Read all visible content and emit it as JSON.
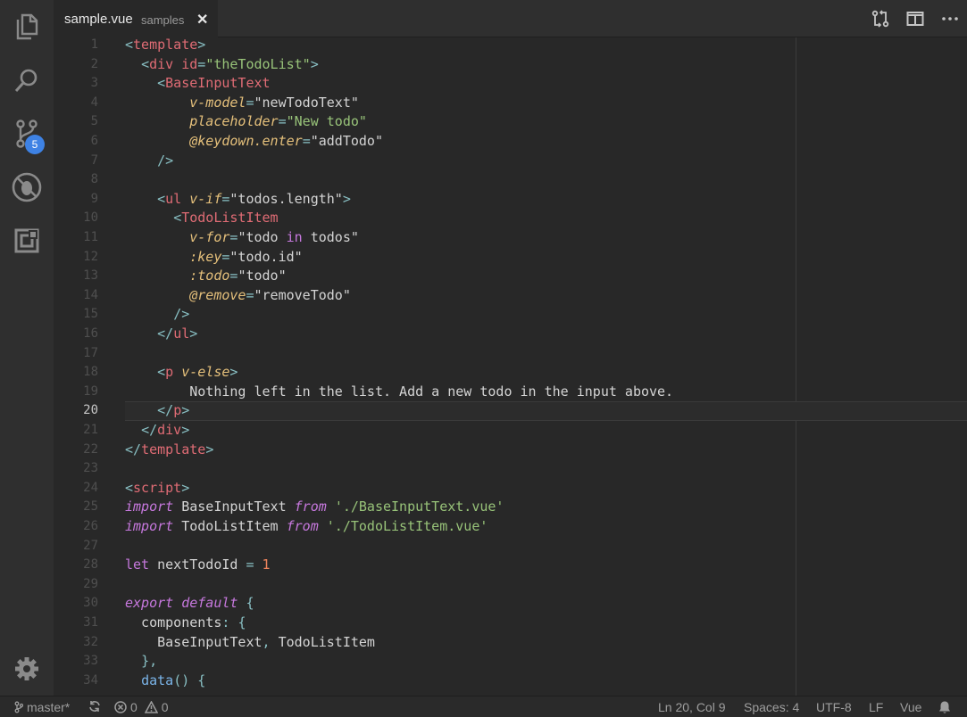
{
  "activity_bar": {
    "scm_badge": "5"
  },
  "tab": {
    "name": "sample.vue",
    "description": "samples",
    "close": "✕"
  },
  "editor": {
    "current_line": 20,
    "lines": [
      [
        [
          "tk-punct",
          "<"
        ],
        [
          "tk-tag",
          "template"
        ],
        [
          "tk-punct",
          ">"
        ]
      ],
      [
        [
          "tk-text",
          "  "
        ],
        [
          "tk-punct",
          "<"
        ],
        [
          "tk-tag",
          "div"
        ],
        [
          "tk-text",
          " "
        ],
        [
          "tk-tag",
          "id"
        ],
        [
          "tk-punct",
          "="
        ],
        [
          "tk-str",
          "\"theTodoList\""
        ],
        [
          "tk-punct",
          ">"
        ]
      ],
      [
        [
          "tk-text",
          "    "
        ],
        [
          "tk-punct",
          "<"
        ],
        [
          "tk-tag",
          "BaseInputText"
        ]
      ],
      [
        [
          "tk-text",
          "        "
        ],
        [
          "tk-attr",
          "v-model"
        ],
        [
          "tk-punct",
          "="
        ],
        [
          "tk-text",
          "\"newTodoText\""
        ]
      ],
      [
        [
          "tk-text",
          "        "
        ],
        [
          "tk-attr",
          "placeholder"
        ],
        [
          "tk-punct",
          "="
        ],
        [
          "tk-str",
          "\"New todo\""
        ]
      ],
      [
        [
          "tk-text",
          "        "
        ],
        [
          "tk-attr",
          "@keydown.enter"
        ],
        [
          "tk-punct",
          "="
        ],
        [
          "tk-text",
          "\"addTodo\""
        ]
      ],
      [
        [
          "tk-text",
          "    "
        ],
        [
          "tk-punct",
          "/>"
        ]
      ],
      [],
      [
        [
          "tk-text",
          "    "
        ],
        [
          "tk-punct",
          "<"
        ],
        [
          "tk-tag",
          "ul"
        ],
        [
          "tk-text",
          " "
        ],
        [
          "tk-attr",
          "v-if"
        ],
        [
          "tk-punct",
          "="
        ],
        [
          "tk-text",
          "\"todos.length\""
        ],
        [
          "tk-punct",
          ">"
        ]
      ],
      [
        [
          "tk-text",
          "      "
        ],
        [
          "tk-punct",
          "<"
        ],
        [
          "tk-tag",
          "TodoListItem"
        ]
      ],
      [
        [
          "tk-text",
          "        "
        ],
        [
          "tk-attr",
          "v-for"
        ],
        [
          "tk-punct",
          "="
        ],
        [
          "tk-text",
          "\"todo "
        ],
        [
          "tk-kwn",
          "in"
        ],
        [
          "tk-text",
          " todos\""
        ]
      ],
      [
        [
          "tk-text",
          "        "
        ],
        [
          "tk-attr",
          ":key"
        ],
        [
          "tk-punct",
          "="
        ],
        [
          "tk-text",
          "\"todo.id\""
        ]
      ],
      [
        [
          "tk-text",
          "        "
        ],
        [
          "tk-attr",
          ":todo"
        ],
        [
          "tk-punct",
          "="
        ],
        [
          "tk-text",
          "\"todo\""
        ]
      ],
      [
        [
          "tk-text",
          "        "
        ],
        [
          "tk-attr",
          "@remove"
        ],
        [
          "tk-punct",
          "="
        ],
        [
          "tk-text",
          "\"removeTodo\""
        ]
      ],
      [
        [
          "tk-text",
          "      "
        ],
        [
          "tk-punct",
          "/>"
        ]
      ],
      [
        [
          "tk-text",
          "    "
        ],
        [
          "tk-punct",
          "</"
        ],
        [
          "tk-tag",
          "ul"
        ],
        [
          "tk-punct",
          ">"
        ]
      ],
      [],
      [
        [
          "tk-text",
          "    "
        ],
        [
          "tk-punct",
          "<"
        ],
        [
          "tk-tag",
          "p"
        ],
        [
          "tk-text",
          " "
        ],
        [
          "tk-attr",
          "v-else"
        ],
        [
          "tk-punct",
          ">"
        ]
      ],
      [
        [
          "tk-text",
          "        Nothing left in the list. Add a new todo in the input above."
        ]
      ],
      [
        [
          "tk-text",
          "    "
        ],
        [
          "tk-punct",
          "</"
        ],
        [
          "tk-tag",
          "p"
        ],
        [
          "tk-punct",
          ">"
        ]
      ],
      [
        [
          "tk-text",
          "  "
        ],
        [
          "tk-punct",
          "</"
        ],
        [
          "tk-tag",
          "div"
        ],
        [
          "tk-punct",
          ">"
        ]
      ],
      [
        [
          "tk-punct",
          "</"
        ],
        [
          "tk-tag",
          "template"
        ],
        [
          "tk-punct",
          ">"
        ]
      ],
      [],
      [
        [
          "tk-punct",
          "<"
        ],
        [
          "tk-tag",
          "script"
        ],
        [
          "tk-punct",
          ">"
        ]
      ],
      [
        [
          "tk-kw",
          "import"
        ],
        [
          "tk-text",
          " BaseInputText "
        ],
        [
          "tk-kw",
          "from"
        ],
        [
          "tk-text",
          " "
        ],
        [
          "tk-str",
          "'./BaseInputText.vue'"
        ]
      ],
      [
        [
          "tk-kw",
          "import"
        ],
        [
          "tk-text",
          " TodoListItem "
        ],
        [
          "tk-kw",
          "from"
        ],
        [
          "tk-text",
          " "
        ],
        [
          "tk-str",
          "'./TodoListItem.vue'"
        ]
      ],
      [],
      [
        [
          "tk-kwn",
          "let"
        ],
        [
          "tk-text",
          " nextTodoId "
        ],
        [
          "tk-punct",
          "="
        ],
        [
          "tk-text",
          " "
        ],
        [
          "tk-num",
          "1"
        ]
      ],
      [],
      [
        [
          "tk-kw",
          "export"
        ],
        [
          "tk-text",
          " "
        ],
        [
          "tk-kw",
          "default"
        ],
        [
          "tk-text",
          " "
        ],
        [
          "tk-punct",
          "{"
        ]
      ],
      [
        [
          "tk-text",
          "  components"
        ],
        [
          "tk-punct",
          ":"
        ],
        [
          "tk-text",
          " "
        ],
        [
          "tk-punct",
          "{"
        ]
      ],
      [
        [
          "tk-text",
          "    BaseInputText"
        ],
        [
          "tk-punct",
          ","
        ],
        [
          "tk-text",
          " TodoListItem"
        ]
      ],
      [
        [
          "tk-text",
          "  "
        ],
        [
          "tk-punct",
          "},"
        ]
      ],
      [
        [
          "tk-text",
          "  "
        ],
        [
          "tk-fn",
          "data"
        ],
        [
          "tk-punct",
          "()"
        ],
        [
          "tk-text",
          " "
        ],
        [
          "tk-punct",
          "{"
        ]
      ]
    ]
  },
  "status_bar": {
    "branch": "master*",
    "errors": "0",
    "warnings": "0",
    "position": "Ln 20, Col 9",
    "spaces": "Spaces: 4",
    "encoding": "UTF-8",
    "eol": "LF",
    "language": "Vue"
  }
}
